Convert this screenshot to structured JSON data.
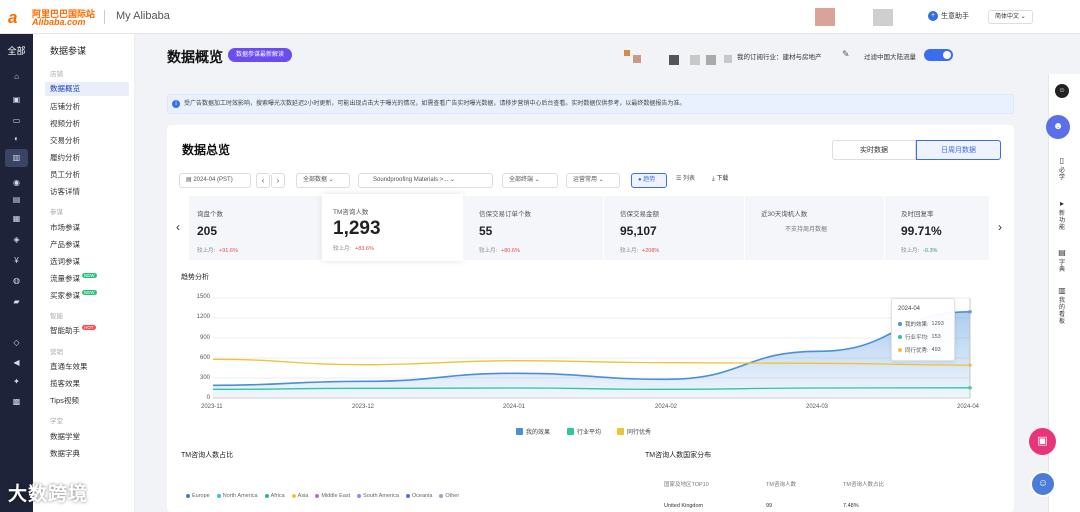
{
  "header": {
    "logo_zh": "阿里巴巴国际站",
    "logo_en": "Alibaba.com",
    "title": "My Alibaba",
    "assistant": "生意助手",
    "language": "简体中文"
  },
  "rail": {
    "title": "全部",
    "icons": [
      "home-icon",
      "store-icon",
      "cart-icon",
      "data-icon",
      "chart-icon",
      "broadcast-icon",
      "ad-icon",
      "document-icon",
      "users-icon",
      "money-icon",
      "globe-icon",
      "truck-icon",
      "shield-icon",
      "megaphone-icon",
      "sparkle-icon",
      "gift-icon"
    ]
  },
  "sidebar": {
    "title": "数据参谋",
    "groups": [
      {
        "label": "店铺",
        "items": [
          "数据概览",
          "店铺分析",
          "视频分析",
          "交易分析",
          "履约分析",
          "员工分析",
          "访客详情"
        ]
      },
      {
        "label": "参谋",
        "items": [
          "市场参谋",
          "产品参谋",
          "选词参谋",
          "流量参谋",
          "买家参谋"
        ]
      },
      {
        "label": "智能",
        "items": [
          "智能助手"
        ]
      },
      {
        "label": "营销",
        "items": [
          "直通车效果",
          "揽客效果",
          "Tips视频"
        ]
      },
      {
        "label": "学堂",
        "items": [
          "数据学堂",
          "数据字典"
        ]
      }
    ],
    "badges": {
      "new": "NEW",
      "hot": "HOT"
    }
  },
  "page": {
    "title": "数据概览",
    "pill": "数据参谋最新解读",
    "industry": "我的订阅行业：建材与房地产",
    "filter_label": "过滤中国大陆流量",
    "notice": "受广告数据加工时效影响，搜索曝光次数延迟2小时更新，可能出现点击大于曝光的情况，如需查看广告实时曝光数据，请移步营销中心后台查看。实时数据仅供参考，以最终数据报告为准。"
  },
  "overview": {
    "title": "数据总览",
    "tab_realtime": "实时数据",
    "tab_period": "日周月数据",
    "date": "2024-04 (PST)",
    "channel": "全部数据",
    "product": "Soundproofing Materials >...",
    "terminal": "全部终端",
    "scope": "运营常用",
    "view_chart": "趋势",
    "view_table": "列表",
    "download": "下载"
  },
  "kpis": [
    {
      "label": "询盘个数",
      "value": "205",
      "sub": "较上月:",
      "delta": "+91.6%",
      "dir": "up"
    },
    {
      "label": "TM咨询人数",
      "value": "1,293",
      "sub": "较上月:",
      "delta": "+83.6%",
      "dir": "up"
    },
    {
      "label": "信保交易订单个数",
      "value": "55",
      "sub": "较上月:",
      "delta": "+80.6%",
      "dir": "up"
    },
    {
      "label": "信保交易金额",
      "value": "95,107",
      "sub": "较上月:",
      "delta": "+208%",
      "dir": "up"
    },
    {
      "label": "近30天询机人数",
      "value": "",
      "sub": "",
      "delta": "",
      "dir": "",
      "na": "不支持周月数据"
    },
    {
      "label": "及时回复率",
      "value": "99.71%",
      "sub": "较上月:",
      "delta": "-0.3%",
      "dir": "dn"
    }
  ],
  "trend": {
    "title": "趋势分析",
    "legend": [
      "我的效果",
      "行业平均",
      "同行优秀"
    ],
    "tooltip": {
      "date": "2024-04",
      "rows": [
        {
          "label": "我的效果:",
          "value": "1293"
        },
        {
          "label": "行业平均:",
          "value": "153"
        },
        {
          "label": "同行优秀:",
          "value": "493"
        }
      ]
    }
  },
  "chart_data": {
    "type": "line",
    "x": [
      "2023-11",
      "2023-12",
      "2024-01",
      "2024-02",
      "2024-03",
      "2024-04"
    ],
    "yticks": [
      "1500",
      "1200",
      "900",
      "600",
      "300",
      "0"
    ],
    "ylim": [
      0,
      1500
    ],
    "series": [
      {
        "name": "我的效果",
        "values": [
          190,
          250,
          370,
          280,
          700,
          1293
        ]
      },
      {
        "name": "行业平均",
        "values": [
          130,
          145,
          150,
          130,
          150,
          153
        ]
      },
      {
        "name": "同行优秀",
        "values": [
          580,
          500,
          560,
          530,
          520,
          493
        ]
      }
    ],
    "colors": [
      "#4a8fdc",
      "#2cc7a0",
      "#f1c233"
    ]
  },
  "map": {
    "title": "TM咨询人数占比",
    "regions": [
      {
        "name": "Europe",
        "color": "#4a73d8"
      },
      {
        "name": "North America",
        "color": "#36c2d1"
      },
      {
        "name": "Africa",
        "color": "#2eb78a"
      },
      {
        "name": "Asia",
        "color": "#f0c23a"
      },
      {
        "name": "Middle East",
        "color": "#b36cd8"
      },
      {
        "name": "South America",
        "color": "#8c8cf0"
      },
      {
        "name": "Oceania",
        "color": "#5b6bd8"
      },
      {
        "name": "Other",
        "color": "#9aa3c2"
      }
    ]
  },
  "country": {
    "title": "TM咨询人数国家分布",
    "headers": [
      "国家及地区TOP10",
      "TM咨询人数",
      "TM咨询人数占比"
    ],
    "rows": [
      [
        "United Kingdom",
        "99",
        "7.48%"
      ]
    ]
  },
  "rightbar": {
    "items": [
      "必学",
      "新功能",
      "字典",
      "我的看板"
    ]
  },
  "watermark": "大数跨境"
}
